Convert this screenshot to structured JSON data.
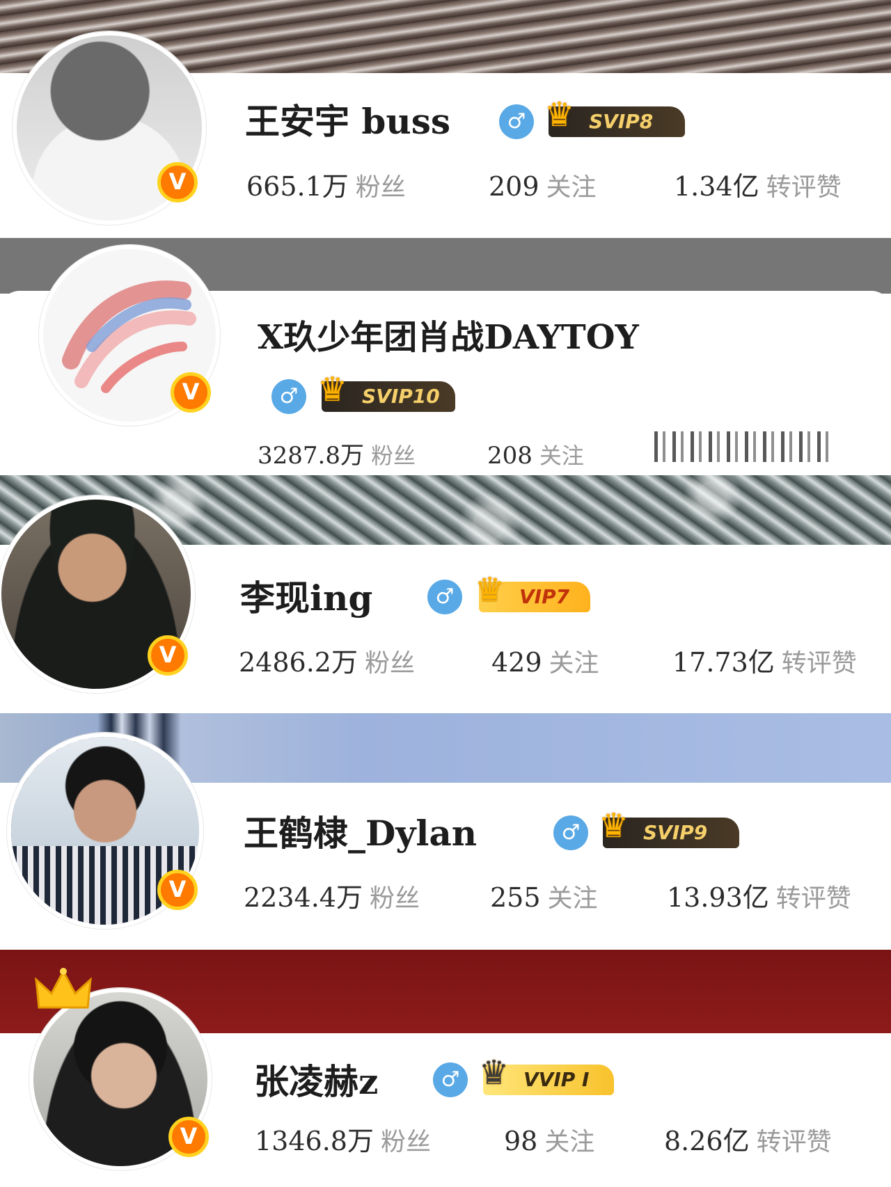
{
  "cards": [
    {
      "name": "王安宇 buss",
      "gender": "♂",
      "vip": "SVIP8",
      "fans": "665.1万",
      "fans_label": "粉丝",
      "follow": "209",
      "follow_label": "关注",
      "likes": "1.34亿",
      "likes_label": "转评赞"
    },
    {
      "name": "X玖少年团肖战DAYTOY",
      "gender": "♂",
      "vip": "SVIP10",
      "fans": "3287.8万",
      "fans_label": "粉丝",
      "follow": "208",
      "follow_label": "关注"
    },
    {
      "name": "李现ing",
      "gender": "♂",
      "vip": "VIP7",
      "fans": "2486.2万",
      "fans_label": "粉丝",
      "follow": "429",
      "follow_label": "关注",
      "likes": "17.73亿",
      "likes_label": "转评赞"
    },
    {
      "name": "王鹤棣_Dylan",
      "gender": "♂",
      "vip": "SVIP9",
      "fans": "2234.4万",
      "fans_label": "粉丝",
      "follow": "255",
      "follow_label": "关注",
      "likes": "13.93亿",
      "likes_label": "转评赞"
    },
    {
      "name": "张凌赫z",
      "gender": "♂",
      "vip": "VVIP I",
      "fans": "1346.8万",
      "fans_label": "粉丝",
      "follow": "98",
      "follow_label": "关注",
      "likes": "8.26亿",
      "likes_label": "转评赞"
    }
  ],
  "badge_letter": "V",
  "icons": {
    "verified": "verified-v-icon",
    "gender": "male-icon",
    "vip_crown": "crown-icon"
  },
  "colors": {
    "verified": "#ff7a00",
    "gender": "#59a9e6",
    "svip_bg": "#2a2520",
    "vip_bg": "#ffc233"
  }
}
